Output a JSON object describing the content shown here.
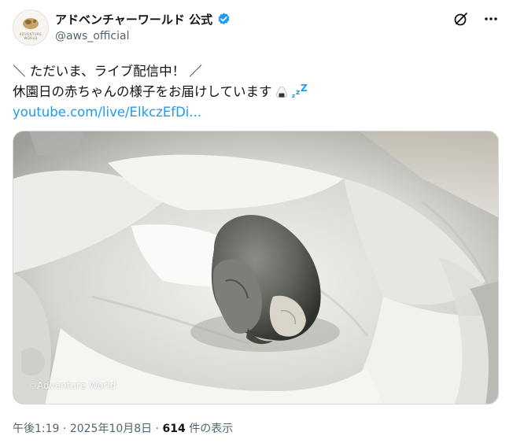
{
  "account": {
    "display_name": "アドベンチャーワールド 公式",
    "handle": "@aws_official",
    "logo_text": "ADVENTURE WORLD",
    "verified_color": "#1d9bf0"
  },
  "tweet": {
    "line1": "＼ ただいま、ライブ配信中！ ／",
    "line2": "休園日の赤ちゃんの様子をお届けしています",
    "line2_emoji": "sleeping-onigiri-zzz",
    "link": "youtube.com/live/ElkczEfDi..."
  },
  "media": {
    "watermark": "©Adventure World",
    "subject": "baby-penguin-in-white-towels"
  },
  "meta": {
    "time": "午後1:19",
    "sep1": "·",
    "date": "2025年10月8日",
    "sep2": "·",
    "views_count": "614",
    "views_label": "件の表示"
  },
  "colors": {
    "link": "#1d9bf0",
    "secondary_text": "#536471",
    "primary_text": "#0f1419"
  }
}
